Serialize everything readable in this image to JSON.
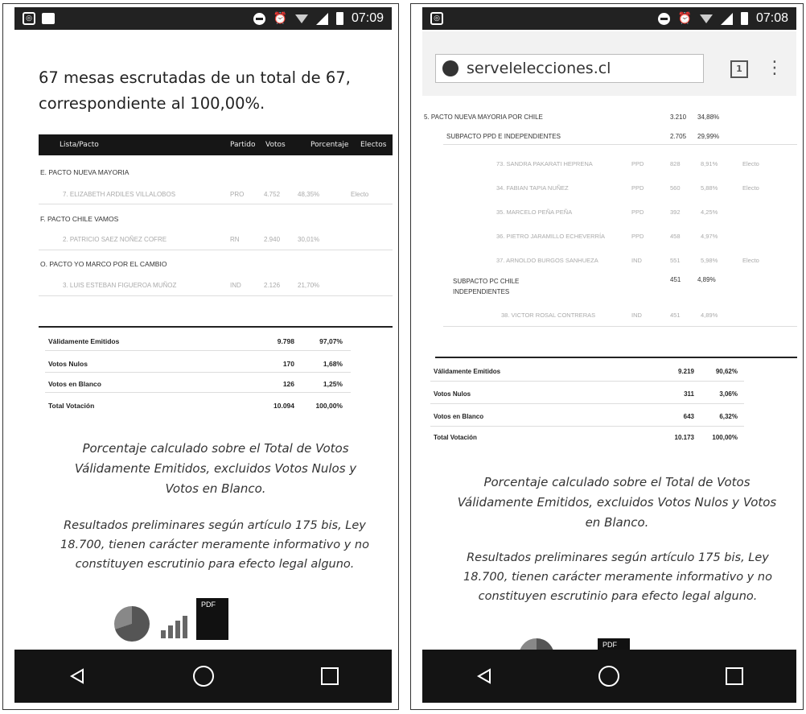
{
  "left": {
    "status": {
      "time": "07:09"
    },
    "headline": "67 mesas escrutadas de un total de 67, correspondiente al 100,00%.",
    "table_headers": [
      "Lista/Pacto",
      "Partido",
      "Votos",
      "Porcentaje",
      "Electos"
    ],
    "groups": [
      {
        "label": "E. PACTO NUEVA MAYORIA",
        "candidate": "7. ELIZABETH ARDILES VILLALOBOS",
        "party": "PRO",
        "votes": "4.752",
        "pct": "48,35%",
        "elected": "Electo"
      },
      {
        "label": "F. PACTO CHILE VAMOS",
        "candidate": "2. PATRICIO SAEZ NOÑEZ COFRE",
        "party": "RN",
        "votes": "2.940",
        "pct": "30,01%",
        "elected": ""
      },
      {
        "label": "O. PACTO YO MARCO POR EL CAMBIO",
        "candidate": "3. LUIS ESTEBAN FIGUEROA MUÑOZ",
        "party": "IND",
        "votes": "2.126",
        "pct": "21,70%",
        "elected": ""
      }
    ],
    "summary": [
      {
        "label": "Válidamente Emitidos",
        "votes": "9.798",
        "pct": "97,07%"
      },
      {
        "label": "Votos Nulos",
        "votes": "170",
        "pct": "1,68%"
      },
      {
        "label": "Votos en Blanco",
        "votes": "126",
        "pct": "1,25%"
      },
      {
        "label": "Total Votación",
        "votes": "10.094",
        "pct": "100,00%"
      }
    ],
    "note1": "Porcentaje calculado sobre el Total de Votos Válidamente Emitidos, excluidos Votos Nulos y Votos en Blanco.",
    "note2": "Resultados preliminares según artículo 175 bis, Ley 18.700, tienen carácter meramente informativo y no constituyen escrutinio para efecto legal alguno.",
    "pdf_label": "PDF"
  },
  "right": {
    "status": {
      "time": "07:08"
    },
    "url": "servelelecciones.cl",
    "tab_count": "1",
    "group_label": "5. PACTO NUEVA MAYORIA POR CHILE",
    "group_votes": "3.210",
    "group_pct": "34,88%",
    "subpact1": {
      "label": "SUBPACTO PPD E INDEPENDIENTES",
      "votes": "2.705",
      "pct": "29,99%"
    },
    "candidates": [
      {
        "name": "73. SANDRA PAKARATI HEPRENA",
        "party": "PPD",
        "votes": "828",
        "pct": "8,91%",
        "elected": "Electo"
      },
      {
        "name": "34. FABIAN TAPIA NUÑEZ",
        "party": "PPD",
        "votes": "560",
        "pct": "5,88%",
        "elected": "Electo"
      },
      {
        "name": "35. MARCELO PEÑA PEÑA",
        "party": "PPD",
        "votes": "392",
        "pct": "4,25%",
        "elected": ""
      },
      {
        "name": "36. PIETRO JARAMILLO ECHEVERRÍA",
        "party": "PPD",
        "votes": "458",
        "pct": "4,97%",
        "elected": ""
      },
      {
        "name": "37. ARNOLDO BURGOS SANHUEZA",
        "party": "IND",
        "votes": "551",
        "pct": "5,98%",
        "elected": "Electo"
      }
    ],
    "subpact2": {
      "label": "SUBPACTO PC CHILE INDEPENDIENTES",
      "votes": "451",
      "pct": "4,89%"
    },
    "subpact2_candidate": {
      "name": "38. VICTOR ROSAL CONTRERAS",
      "party": "IND",
      "votes": "451",
      "pct": "4,89%"
    },
    "summary": [
      {
        "label": "Válidamente Emitidos",
        "votes": "9.219",
        "pct": "90,62%"
      },
      {
        "label": "Votos Nulos",
        "votes": "311",
        "pct": "3,06%"
      },
      {
        "label": "Votos en Blanco",
        "votes": "643",
        "pct": "6,32%"
      },
      {
        "label": "Total Votación",
        "votes": "10.173",
        "pct": "100,00%"
      }
    ],
    "note1": "Porcentaje calculado sobre el Total de Votos Válidamente Emitidos, excluidos Votos Nulos y Votos en Blanco.",
    "note2": "Resultados preliminares según artículo 175 bis, Ley 18.700, tienen carácter meramente informativo y no constituyen escrutinio para efecto legal alguno.",
    "pdf_label": "PDF"
  }
}
